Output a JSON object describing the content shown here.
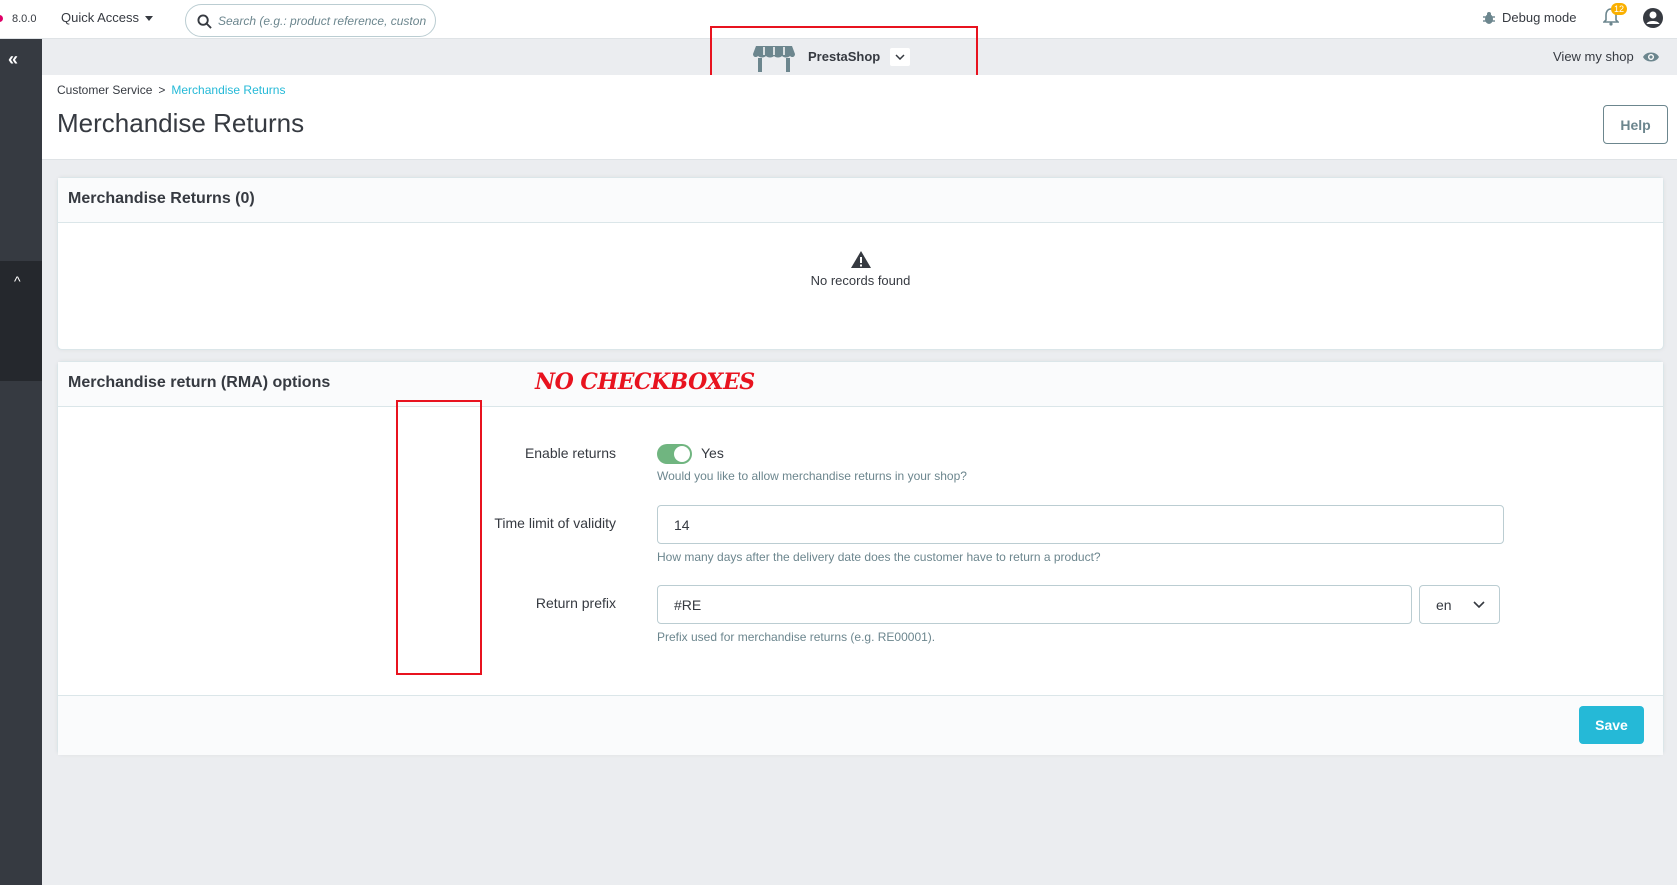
{
  "topbar": {
    "version": "8.0.0",
    "quick_access": "Quick Access",
    "search_placeholder": "Search (e.g.: product reference, custon",
    "debug_mode": "Debug mode",
    "notifications_count": "12"
  },
  "shopbar": {
    "shop_name": "PrestaShop",
    "view_my_shop": "View my shop"
  },
  "header": {
    "breadcrumb_parent": "Customer Service",
    "breadcrumb_separator": ">",
    "breadcrumb_current": "Merchandise Returns",
    "title": "Merchandise Returns",
    "help_label": "Help"
  },
  "returns_panel": {
    "title": "Merchandise Returns (0)",
    "empty_text": "No records found"
  },
  "options_panel": {
    "title": "Merchandise return (RMA) options",
    "annotation": "NO CHECKBOXES",
    "enable_returns_label": "Enable returns",
    "enable_returns_value": "Yes",
    "enable_returns_help": "Would you like to allow merchandise returns in your shop?",
    "time_limit_label": "Time limit of validity",
    "time_limit_value": "14",
    "time_limit_help": "How many days after the delivery date does the customer have to return a product?",
    "prefix_label": "Return prefix",
    "prefix_value": "#RE",
    "prefix_lang": "en",
    "prefix_help": "Prefix used for merchandise returns (e.g. RE00001).",
    "save_label": "Save"
  },
  "colors": {
    "accent": "#25b9d7",
    "toggle_on": "#70b580",
    "annotation_red": "#e8131f"
  }
}
